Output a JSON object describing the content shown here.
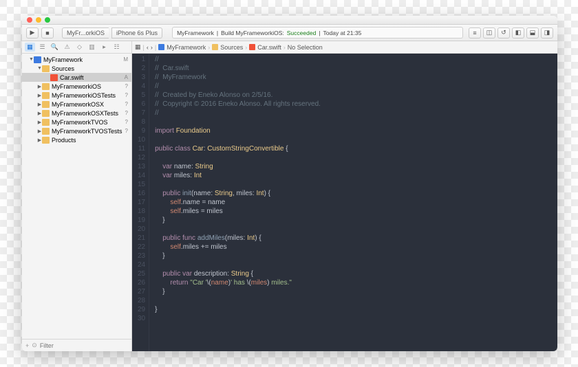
{
  "titlebar": {
    "scheme_target": "MyFr...orkiOS",
    "scheme_device": "iPhone 6s Plus"
  },
  "status": {
    "project": "MyFramework",
    "action": "Build MyFrameworkiOS:",
    "result": "Succeeded",
    "time": "Today at 21:35"
  },
  "jumpbar": {
    "project": "MyFramework",
    "folder": "Sources",
    "file": "Car.swift",
    "selection": "No Selection"
  },
  "tree": {
    "root": {
      "name": "MyFramework",
      "status": "M"
    },
    "sources": {
      "name": "Sources"
    },
    "file": {
      "name": "Car.swift",
      "status": "A"
    },
    "targets": [
      {
        "name": "MyFrameworkiOS",
        "status": "?"
      },
      {
        "name": "MyFrameworkiOSTests",
        "status": "?"
      },
      {
        "name": "MyFrameworkOSX",
        "status": "?"
      },
      {
        "name": "MyFrameworkOSXTests",
        "status": "?"
      },
      {
        "name": "MyFrameworkTVOS",
        "status": "?"
      },
      {
        "name": "MyFrameworkTVOSTests",
        "status": "?"
      },
      {
        "name": "Products"
      }
    ]
  },
  "filter": {
    "placeholder": "Filter"
  },
  "code": {
    "lines": [
      {
        "n": 1,
        "t": "comment",
        "s": "//"
      },
      {
        "n": 2,
        "t": "comment",
        "s": "//  Car.swift"
      },
      {
        "n": 3,
        "t": "comment",
        "s": "//  MyFramework"
      },
      {
        "n": 4,
        "t": "comment",
        "s": "//"
      },
      {
        "n": 5,
        "t": "comment",
        "s": "//  Created by Eneko Alonso on 2/5/16."
      },
      {
        "n": 6,
        "t": "comment",
        "s": "//  Copyright © 2016 Eneko Alonso. All rights reserved."
      },
      {
        "n": 7,
        "t": "comment",
        "s": "//"
      },
      {
        "n": 8,
        "t": "plain",
        "s": ""
      },
      {
        "n": 9,
        "t": "import",
        "s": "import Foundation"
      },
      {
        "n": 10,
        "t": "plain",
        "s": ""
      },
      {
        "n": 11,
        "t": "classdecl",
        "s": "public class Car: CustomStringConvertible {"
      },
      {
        "n": 12,
        "t": "plain",
        "s": ""
      },
      {
        "n": 13,
        "t": "vardecl",
        "s": "    var name: String"
      },
      {
        "n": 14,
        "t": "vardecl",
        "s": "    var miles: Int"
      },
      {
        "n": 15,
        "t": "plain",
        "s": ""
      },
      {
        "n": 16,
        "t": "funcdecl",
        "s": "    public init(name: String, miles: Int) {"
      },
      {
        "n": 17,
        "t": "selfassign",
        "s": "        self.name = name"
      },
      {
        "n": 18,
        "t": "selfassign",
        "s": "        self.miles = miles"
      },
      {
        "n": 19,
        "t": "plain",
        "s": "    }"
      },
      {
        "n": 20,
        "t": "plain",
        "s": ""
      },
      {
        "n": 21,
        "t": "funcdecl2",
        "s": "    public func addMiles(miles: Int) {"
      },
      {
        "n": 22,
        "t": "selfop",
        "s": "        self.miles += miles"
      },
      {
        "n": 23,
        "t": "plain",
        "s": "    }"
      },
      {
        "n": 24,
        "t": "plain",
        "s": ""
      },
      {
        "n": 25,
        "t": "vardecl2",
        "s": "    public var description: String {"
      },
      {
        "n": 26,
        "t": "return",
        "s": "        return \"Car '\\(name)' has \\(miles) miles.\""
      },
      {
        "n": 27,
        "t": "plain",
        "s": "    }"
      },
      {
        "n": 28,
        "t": "plain",
        "s": ""
      },
      {
        "n": 29,
        "t": "plain",
        "s": "}"
      },
      {
        "n": 30,
        "t": "plain",
        "s": ""
      }
    ]
  }
}
